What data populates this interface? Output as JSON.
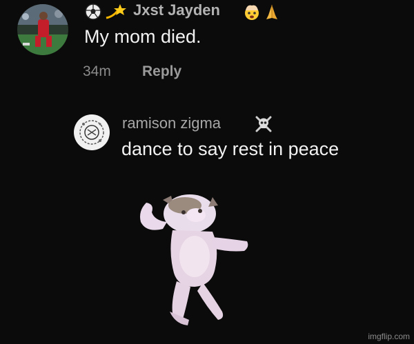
{
  "comment": {
    "username": "Jxst Jayden",
    "text": "My mom died.",
    "timestamp": "34m",
    "reply_label": "Reply",
    "username_prefix_icons": [
      "soccer-ball-icon",
      "dizzy-star-icon"
    ],
    "username_suffix_icons": [
      "exploding-head-icon",
      "folded-hands-icon"
    ]
  },
  "reply": {
    "username": "ramison zigma",
    "text": "dance to say rest in peace",
    "username_suffix_icons": [
      "skull-crossbones-icon"
    ]
  },
  "media": {
    "subject": "dancing-cat-gif"
  },
  "watermark": "imgflip.com",
  "colors": {
    "background": "#0b0b0b",
    "text": "#f2f2f2",
    "muted": "#8a8a8a"
  }
}
